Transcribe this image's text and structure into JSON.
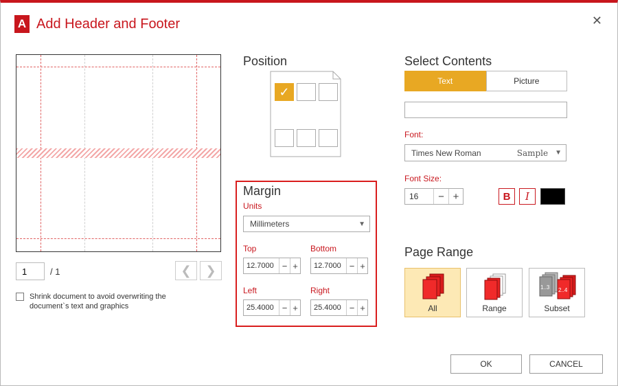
{
  "dialog": {
    "title": "Add Header and Footer",
    "logo_glyph": "A",
    "close_glyph": "✕"
  },
  "preview": {
    "page_number": "1",
    "page_total": "/ 1",
    "prev_glyph": "❮",
    "next_glyph": "❯",
    "shrink_label": "Shrink document to avoid overwriting the document`s text and graphics",
    "shrink_checked": false
  },
  "position": {
    "title": "Position",
    "selected_cell": "top-left",
    "check_glyph": "✓"
  },
  "margin": {
    "title": "Margin",
    "units_label": "Units",
    "units_value": "Millimeters",
    "top_label": "Top",
    "top_value": "12.7000",
    "bottom_label": "Bottom",
    "bottom_value": "12.7000",
    "left_label": "Left",
    "left_value": "25.4000",
    "right_label": "Right",
    "right_value": "25.4000",
    "minus": "−",
    "plus": "+"
  },
  "contents": {
    "title": "Select Contents",
    "tab_text": "Text",
    "tab_picture": "Picture",
    "active_tab": "Text",
    "text_value": "",
    "font_label": "Font:",
    "font_value": "Times New Roman",
    "font_sample": "Sample",
    "font_size_label": "Font Size:",
    "font_size_value": "16",
    "bold_glyph": "B",
    "italic_glyph": "I",
    "color": "#000000"
  },
  "page_range": {
    "title": "Page Range",
    "all_label": "All",
    "range_label": "Range",
    "subset_label": "Subset",
    "subset_odd": "1..3",
    "subset_even": "2..4",
    "active": "All"
  },
  "actions": {
    "ok_label": "OK",
    "cancel_label": "CANCEL"
  },
  "colors": {
    "accent": "#c8161d",
    "highlight": "#e8a823",
    "selected_bg": "#fde9b5"
  }
}
